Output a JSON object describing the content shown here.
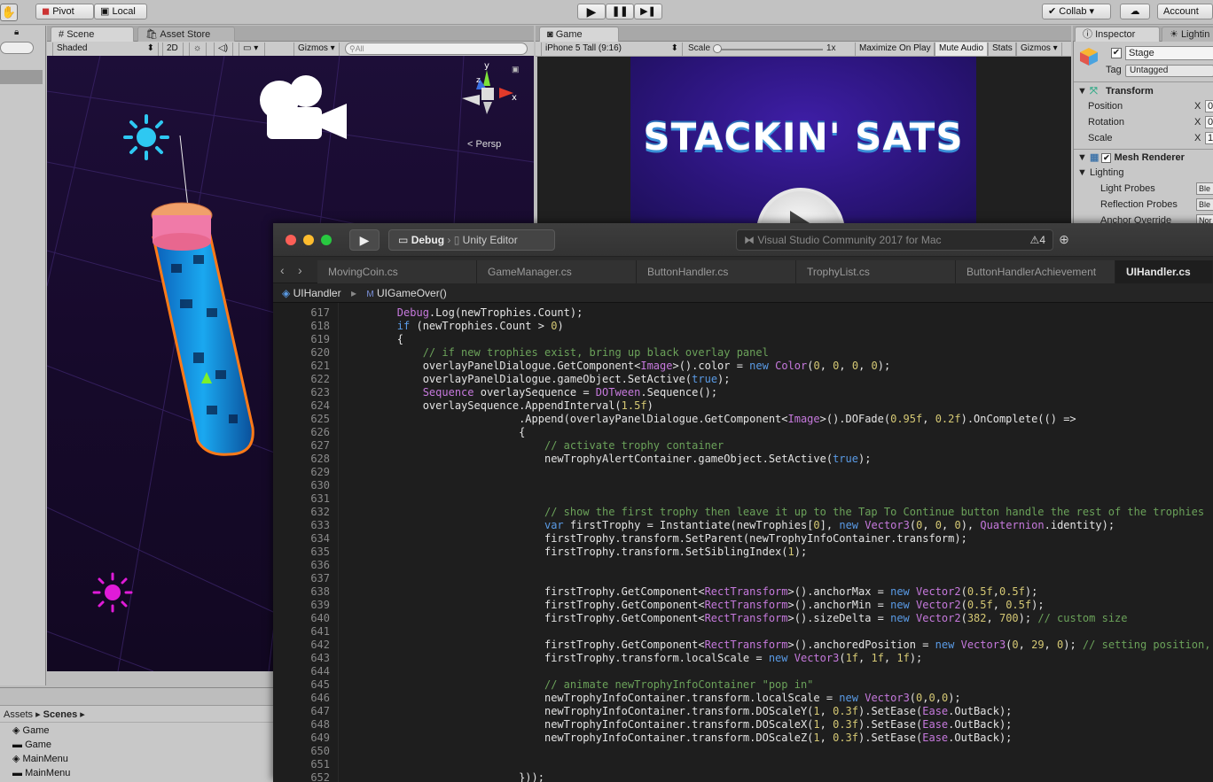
{
  "toolbar": {
    "pivot": "Pivot",
    "local": "Local",
    "collab": "Collab ▾",
    "account": "Account"
  },
  "scene": {
    "tab": "Scene",
    "tab2": "Asset Store",
    "shading": "Shaded",
    "mode2d": "2D",
    "gizmos": "Gizmos",
    "search_placeholder": "All",
    "persp": "Persp"
  },
  "game": {
    "tab": "Game",
    "device": "iPhone 5 Tall (9:16)",
    "scale_label": "Scale",
    "scale_value": "1x",
    "maximize": "Maximize On Play",
    "mute": "Mute Audio",
    "stats": "Stats",
    "gizmos": "Gizmos",
    "logo": "STACKIN' SATS"
  },
  "inspector": {
    "tab": "Inspector",
    "tab2": "Lightin",
    "object_name": "Stage",
    "tag_label": "Tag",
    "tag_value": "Untagged",
    "transform": "Transform",
    "position": "Position",
    "rotation": "Rotation",
    "scale": "Scale",
    "x": "X",
    "pos_x": "0",
    "rot_x": "0",
    "scale_x": "1",
    "mesh_renderer": "Mesh Renderer",
    "lighting": "Lighting",
    "light_probes": "Light Probes",
    "light_probes_val": "Ble",
    "reflection_probes": "Reflection Probes",
    "reflection_probes_val": "Ble",
    "anchor_override": "Anchor Override",
    "anchor_override_val": "Nor"
  },
  "project": {
    "assets": "Assets",
    "sep": "▸",
    "scenes": "Scenes",
    "items": [
      "Game",
      "Game",
      "MainMenu",
      "MainMenu"
    ]
  },
  "vs": {
    "config": "Debug",
    "target": "Unity Editor",
    "app_title": "Visual Studio Community 2017 for Mac",
    "warn_count": "4",
    "tabs": [
      "MovingCoin.cs",
      "GameManager.cs",
      "ButtonHandler.cs",
      "TrophyList.cs",
      "ButtonHandlerAchievement",
      "UIHandler.cs"
    ],
    "crumb_class": "UIHandler",
    "crumb_method": "UIGameOver()",
    "code": [
      {
        "n": "617",
        "t": "        <span class='ty'>Debug</span>.Log(newTrophies.Count);"
      },
      {
        "n": "618",
        "t": "        <span class='kw'>if</span> (newTrophies.Count &gt; <span class='nm'>0</span>)"
      },
      {
        "n": "619",
        "t": "        {"
      },
      {
        "n": "620",
        "t": "            <span class='cm'>// if new trophies exist, bring up black overlay panel</span>"
      },
      {
        "n": "621",
        "t": "            overlayPanelDialogue.GetComponent&lt;<span class='ty'>Image</span>&gt;().color = <span class='kw'>new</span> <span class='ty'>Color</span>(<span class='nm'>0</span>, <span class='nm'>0</span>, <span class='nm'>0</span>, <span class='nm'>0</span>);"
      },
      {
        "n": "622",
        "t": "            overlayPanelDialogue.gameObject.SetActive(<span class='kw'>true</span>);"
      },
      {
        "n": "623",
        "t": "            <span class='ty'>Sequence</span> overlaySequence = <span class='ty'>DOTween</span>.Sequence();"
      },
      {
        "n": "624",
        "t": "            overlaySequence.AppendInterval(<span class='nm'>1.5f</span>)"
      },
      {
        "n": "625",
        "t": "                           .Append(overlayPanelDialogue.GetComponent&lt;<span class='ty'>Image</span>&gt;().DOFade(<span class='nm'>0.95f</span>, <span class='nm'>0.2f</span>).OnComplete(() =&gt;"
      },
      {
        "n": "626",
        "t": "                           {"
      },
      {
        "n": "627",
        "t": "                               <span class='cm'>// activate trophy container</span>"
      },
      {
        "n": "628",
        "t": "                               newTrophyAlertContainer.gameObject.SetActive(<span class='kw'>true</span>);"
      },
      {
        "n": "629",
        "t": ""
      },
      {
        "n": "630",
        "t": ""
      },
      {
        "n": "631",
        "t": ""
      },
      {
        "n": "632",
        "t": "                               <span class='cm'>// show the first trophy then leave it up to the Tap To Continue button handle the rest of the trophies</span>"
      },
      {
        "n": "633",
        "t": "                               <span class='kw'>var</span> firstTrophy = Instantiate(newTrophies[<span class='nm'>0</span>], <span class='kw'>new</span> <span class='ty'>Vector3</span>(<span class='nm'>0</span>, <span class='nm'>0</span>, <span class='nm'>0</span>), <span class='ty'>Quaternion</span>.identity);"
      },
      {
        "n": "634",
        "t": "                               firstTrophy.transform.SetParent(newTrophyInfoContainer.transform);"
      },
      {
        "n": "635",
        "t": "                               firstTrophy.transform.SetSiblingIndex(<span class='nm'>1</span>);"
      },
      {
        "n": "636",
        "t": ""
      },
      {
        "n": "637",
        "t": ""
      },
      {
        "n": "638",
        "t": "                               firstTrophy.GetComponent&lt;<span class='ty'>RectTransform</span>&gt;().anchorMax = <span class='kw'>new</span> <span class='ty'>Vector2</span>(<span class='nm'>0.5f</span>,<span class='nm'>0.5f</span>);"
      },
      {
        "n": "639",
        "t": "                               firstTrophy.GetComponent&lt;<span class='ty'>RectTransform</span>&gt;().anchorMin = <span class='kw'>new</span> <span class='ty'>Vector2</span>(<span class='nm'>0.5f</span>, <span class='nm'>0.5f</span>);"
      },
      {
        "n": "640",
        "t": "                               firstTrophy.GetComponent&lt;<span class='ty'>RectTransform</span>&gt;().sizeDelta = <span class='kw'>new</span> <span class='ty'>Vector2</span>(<span class='nm'>382</span>, <span class='nm'>700</span>); <span class='cm'>// custom size</span>"
      },
      {
        "n": "641",
        "t": ""
      },
      {
        "n": "642",
        "t": "                               firstTrophy.GetComponent&lt;<span class='ty'>RectTransform</span>&gt;().anchoredPosition = <span class='kw'>new</span> <span class='ty'>Vector3</span>(<span class='nm'>0</span>, <span class='nm'>29</span>, <span class='nm'>0</span>); <span class='cm'>// setting position,</span>"
      },
      {
        "n": "643",
        "t": "                               firstTrophy.transform.localScale = <span class='kw'>new</span> <span class='ty'>Vector3</span>(<span class='nm'>1f</span>, <span class='nm'>1f</span>, <span class='nm'>1f</span>);"
      },
      {
        "n": "644",
        "t": ""
      },
      {
        "n": "645",
        "t": "                               <span class='cm'>// animate newTrophyInfoContainer \"pop in\"</span>"
      },
      {
        "n": "646",
        "t": "                               newTrophyInfoContainer.transform.localScale = <span class='kw'>new</span> <span class='ty'>Vector3</span>(<span class='nm'>0</span>,<span class='nm'>0</span>,<span class='nm'>0</span>);"
      },
      {
        "n": "647",
        "t": "                               newTrophyInfoContainer.transform.DOScaleY(<span class='nm'>1</span>, <span class='nm'>0.3f</span>).SetEase(<span class='ty'>Ease</span>.OutBack);"
      },
      {
        "n": "648",
        "t": "                               newTrophyInfoContainer.transform.DOScaleX(<span class='nm'>1</span>, <span class='nm'>0.3f</span>).SetEase(<span class='ty'>Ease</span>.OutBack);"
      },
      {
        "n": "649",
        "t": "                               newTrophyInfoContainer.transform.DOScaleZ(<span class='nm'>1</span>, <span class='nm'>0.3f</span>).SetEase(<span class='ty'>Ease</span>.OutBack);"
      },
      {
        "n": "650",
        "t": ""
      },
      {
        "n": "651",
        "t": ""
      },
      {
        "n": "652",
        "t": "                           }));"
      }
    ]
  },
  "colors": {
    "vs_bg": "#1e1e1e",
    "keyword": "#5a9be6",
    "type": "#c679dd",
    "comment": "#6ba25a",
    "number": "#d5c874"
  }
}
